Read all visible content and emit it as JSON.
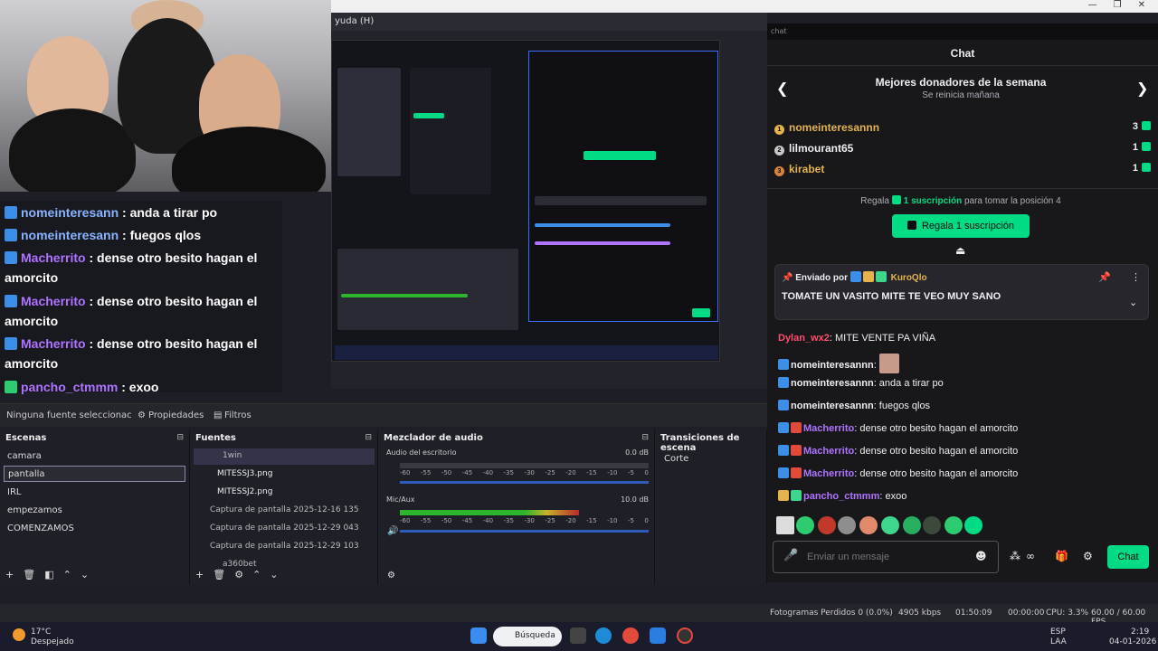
{
  "window": {
    "menu_fragment": "yuda (H)"
  },
  "chat_browser": {
    "address": "chat"
  },
  "overlay_chat": [
    {
      "user": "nomeinteresann",
      "text": " : anda a tirar po"
    },
    {
      "user": "nomeinteresann",
      "text": " : fuegos qlos"
    },
    {
      "user": "Macherrito",
      "text": " : dense otro besito hagan el amorcito"
    },
    {
      "user": "Macherrito",
      "text": " : dense otro besito hagan el amorcito"
    },
    {
      "user": "Macherrito",
      "text": " : dense otro besito hagan el amorcito"
    },
    {
      "user": "pancho_ctmmm",
      "text": " : exoo"
    }
  ],
  "source_toolbar": {
    "no_source": "Ninguna fuente seleccionac",
    "properties": "Propiedades",
    "filters": "Filtros"
  },
  "docks": {
    "scenes": "Escenas",
    "sources": "Fuentes",
    "mixer": "Mezclador de audio",
    "transitions": "Transiciones de escena"
  },
  "scenes": [
    "camara",
    "pantalla",
    "IRL",
    "empezamos",
    "COMENZAMOS"
  ],
  "sources": [
    "1win",
    "MITESSJ3.png",
    "MITESSJ2.png",
    "Captura de pantalla 2025-12-16 135",
    "Captura de pantalla 2025-12-29 043",
    "Captura de pantalla 2025-12-29 103",
    "a360bet"
  ],
  "mixer": {
    "track1": {
      "name": "Audio del escritorio",
      "db": "0.0 dB"
    },
    "track2": {
      "name": "Mic/Aux",
      "db": "10.0 dB"
    },
    "ticks": [
      "-60",
      "-55",
      "-50",
      "-45",
      "-40",
      "-35",
      "-30",
      "-25",
      "-20",
      "-15",
      "-10",
      "-5",
      "0"
    ],
    "track1_level": 0.0,
    "track2_level": 0.72
  },
  "transition": "Corte",
  "status": {
    "dropped": "Fotogramas Perdidos 0 (0.0%)",
    "kbps": "4905 kbps",
    "live_time": "01:50:09",
    "rec_time": "00:00:00",
    "cpu": "CPU: 3.3%",
    "fps": "60.00 / 60.00 FPS"
  },
  "taskbar": {
    "weather_temp": "17°C",
    "weather_desc": "Despejado",
    "search": "Búsqueda",
    "lang1": "ESP",
    "lang2": "LAA",
    "time": "2:19",
    "date": "04-01-2026"
  },
  "chat": {
    "title": "Chat",
    "donors_title": "Mejores donadores de la semana",
    "donors_sub": "Se reinicia mañana",
    "donors": [
      {
        "rank": "1",
        "name": "nomeinteresannn",
        "count": "3",
        "color": "#e5b34e"
      },
      {
        "rank": "2",
        "name": "lilmourant65",
        "count": "1",
        "color": "#c6c6c6"
      },
      {
        "rank": "3",
        "name": "kirabet",
        "count": "1",
        "color": "#d9813a"
      }
    ],
    "gift_pre": "Regala ",
    "gift_bold": "1 suscripción",
    "gift_post": " para tomar la posición 4",
    "gift_button": "Regala 1 suscripción",
    "pin_by": "Enviado por",
    "pin_user": "KuroQlo",
    "pin_message": "TOMATE UN VASITO MITE TE VEO MUY SANO",
    "messages": [
      {
        "user": "Dylan_wx2",
        "text": ": MITE VENTE PA VIÑA",
        "color": "#ff4d6d"
      },
      {
        "user": "nomeinteresannn",
        "text": ":",
        "color": "#efeff1"
      },
      {
        "user": "nomeinteresannn",
        "text": ": anda a tirar po",
        "color": "#efeff1"
      },
      {
        "user": "nomeinteresannn",
        "text": ": fuegos qlos",
        "color": "#efeff1"
      },
      {
        "user": "Macherrito",
        "text": ": dense otro besito hagan el amorcito",
        "color": "#b073ff"
      },
      {
        "user": "Macherrito",
        "text": ": dense otro besito hagan el amorcito",
        "color": "#b073ff"
      },
      {
        "user": "Macherrito",
        "text": ": dense otro besito hagan el amorcito",
        "color": "#b073ff"
      },
      {
        "user": "pancho_ctmmm",
        "text": ": exoo",
        "color": "#b073ff"
      }
    ],
    "input_placeholder": "Enviar un mensaje",
    "send": "Chat"
  },
  "colors": {
    "accent": "#00db84",
    "obs_bg": "#1f2027",
    "chat_bg": "#18181b"
  }
}
